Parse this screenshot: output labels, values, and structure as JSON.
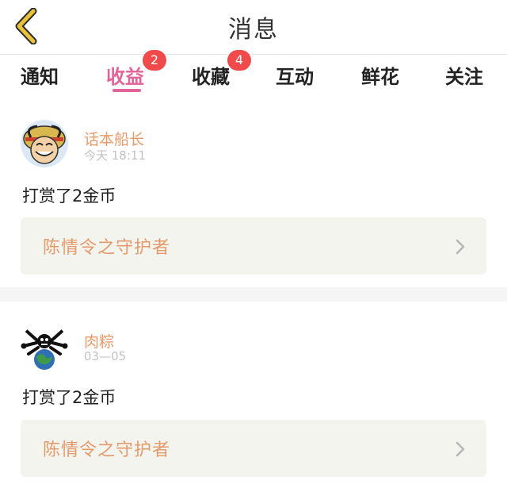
{
  "header": {
    "title": "消息"
  },
  "tabs": [
    {
      "label": "通知"
    },
    {
      "label": "收益",
      "badge": "2",
      "active": true
    },
    {
      "label": "收藏",
      "badge": "4"
    },
    {
      "label": "互动"
    },
    {
      "label": "鲜花"
    },
    {
      "label": "关注"
    }
  ],
  "messages": [
    {
      "username": "话本船长",
      "time": "今天  18:11",
      "text": "打赏了2金币",
      "book": "陈情令之守护者",
      "avatar_icon": "luffy-avatar-icon"
    },
    {
      "username": "肉粽",
      "time": "03—05",
      "text": "打赏了2金币",
      "book": "陈情令之守护者",
      "avatar_icon": "skull-globe-avatar-icon"
    }
  ],
  "colors": {
    "accent": "#e0639a",
    "badge": "#f04a4a",
    "username": "#e49a6a",
    "back_arrow": "#e8c23a"
  }
}
